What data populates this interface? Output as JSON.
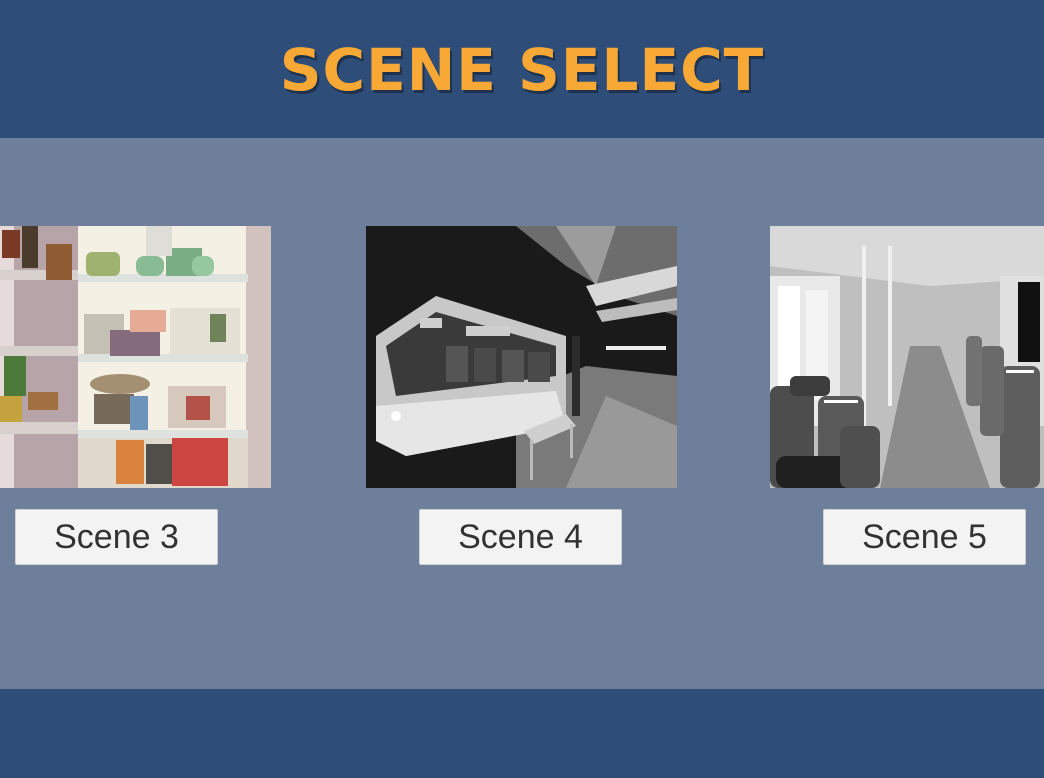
{
  "title": "SCENE SELECT",
  "colors": {
    "header_bg": "#2f4d79",
    "panel_bg": "#6e7f9b",
    "title": "#f8a935",
    "button_bg": "#f3f3f3",
    "button_text": "#323232"
  },
  "scenes": [
    {
      "label": "Scene 3",
      "thumbnail": "open refrigerator with food shelves (color)"
    },
    {
      "label": "Scene 4",
      "thumbnail": "tram at night platform (grayscale)"
    },
    {
      "label": "Scene 5",
      "thumbnail": "tram interior with seats (grayscale)"
    }
  ]
}
